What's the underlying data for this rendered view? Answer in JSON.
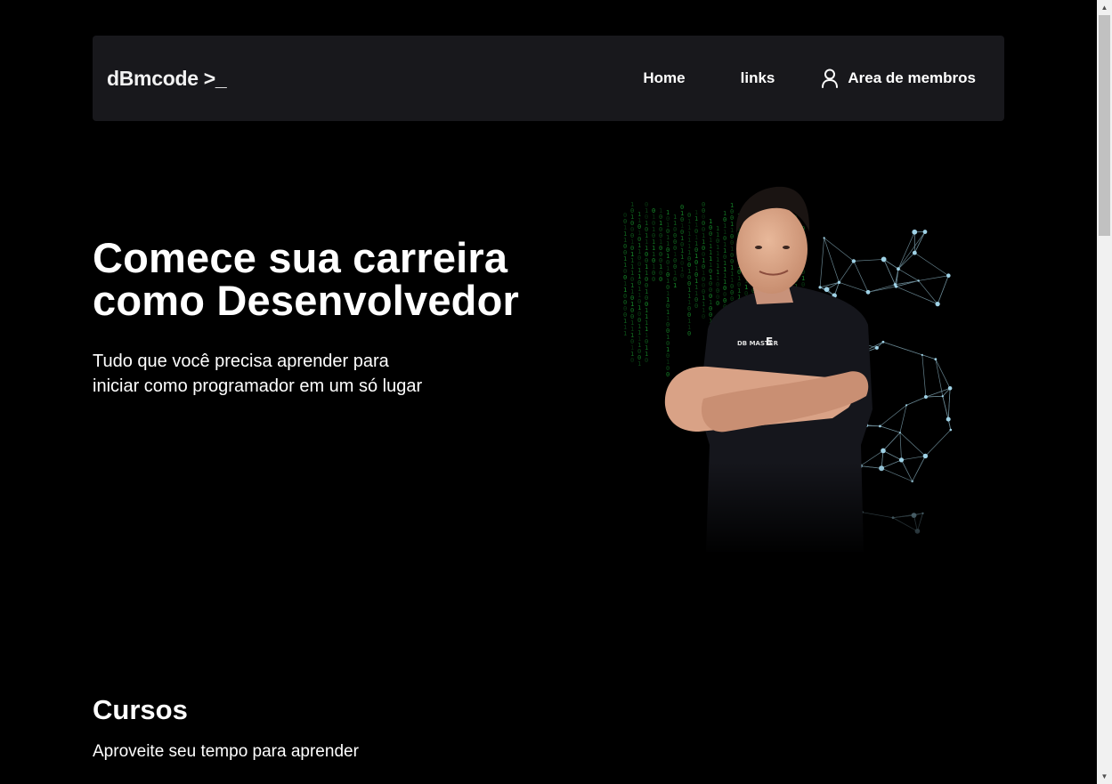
{
  "header": {
    "logo": "dBmcode >_",
    "nav": {
      "home": "Home",
      "links": "links",
      "members": "Area de membros"
    }
  },
  "hero": {
    "title_line1": "Comece sua carreira",
    "title_line2": "como Desenvolvedor",
    "subtitle": "Tudo que você precisa aprender para iniciar como programador em um só lugar"
  },
  "courses": {
    "title": "Cursos",
    "subtitle": "Aproveite seu tempo para aprender"
  },
  "colors": {
    "background": "#000000",
    "navbar": "#18181c",
    "text": "#ffffff",
    "matrix_green": "#1fbf3a",
    "network_lines": "#8fb8c8"
  },
  "icons": {
    "members": "user-icon",
    "scroll_up": "scroll-up-arrow-icon",
    "scroll_down": "scroll-down-arrow-icon"
  }
}
